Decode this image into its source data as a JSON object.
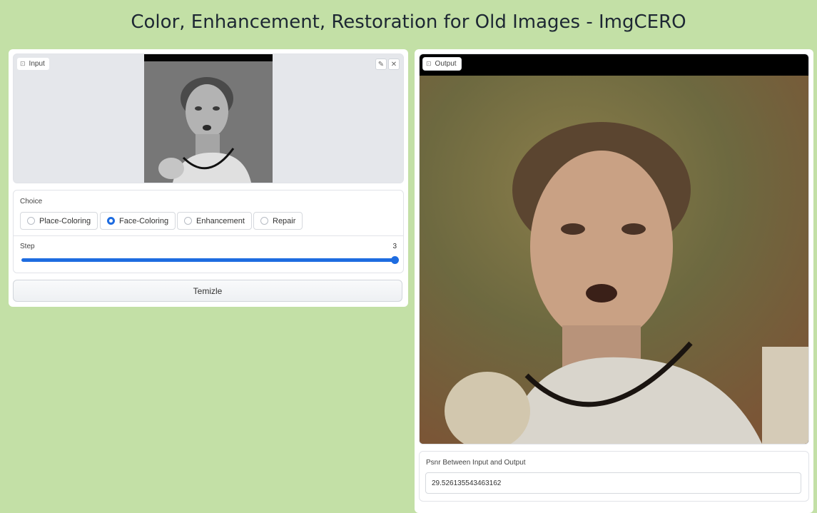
{
  "header": {
    "title": "Color, Enhancement, Restoration for Old Images - ImgCERO"
  },
  "input": {
    "chip_label": "Input",
    "edit_icon": "pencil-icon",
    "close_icon": "close-icon",
    "image_icon": "image-icon"
  },
  "choice": {
    "label": "Choice",
    "options": [
      "Place-Coloring",
      "Face-Coloring",
      "Enhancement",
      "Repair"
    ],
    "selected": "Face-Coloring"
  },
  "step": {
    "label": "Step",
    "value": "3"
  },
  "clear_button": "Temizle",
  "output": {
    "chip_label": "Output"
  },
  "psnr": {
    "label": "Psnr Between Input and Output",
    "value": "29.526135543463162"
  },
  "colors": {
    "background": "#c3e0a6",
    "accent": "#1e6ce0"
  }
}
